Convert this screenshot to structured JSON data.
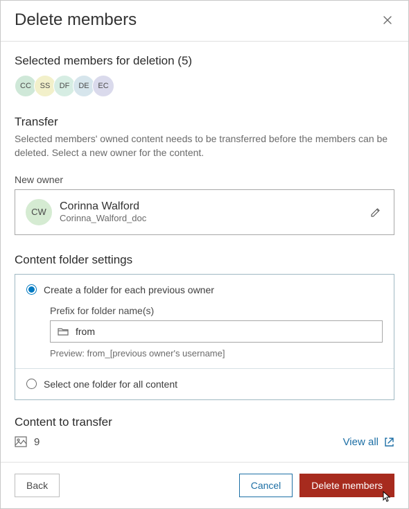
{
  "header": {
    "title": "Delete members"
  },
  "selected": {
    "heading": "Selected members for deletion (5)",
    "avatars": [
      "CC",
      "SS",
      "DF",
      "DE",
      "EC"
    ]
  },
  "transfer": {
    "heading": "Transfer",
    "helper": "Selected members' owned content needs to be transferred before the members can be deleted. Select a new owner for the content.",
    "new_owner_label": "New owner",
    "owner": {
      "initials": "CW",
      "name": "Corinna Walford",
      "username": "Corinna_Walford_doc"
    }
  },
  "folder_settings": {
    "heading": "Content folder settings",
    "option_per_owner": "Create a folder for each previous owner",
    "prefix_label": "Prefix for folder name(s)",
    "prefix_value": "from",
    "preview": "Preview: from_[previous owner's username]",
    "option_single": "Select one folder for all content"
  },
  "content_transfer": {
    "heading": "Content to transfer",
    "count": "9",
    "view_all": "View all"
  },
  "footer": {
    "back": "Back",
    "cancel": "Cancel",
    "delete": "Delete members"
  },
  "icons": {
    "close": "close-icon",
    "pencil": "pencil-icon",
    "folder": "folder-icon",
    "image": "image-icon",
    "external": "external-link-icon"
  }
}
